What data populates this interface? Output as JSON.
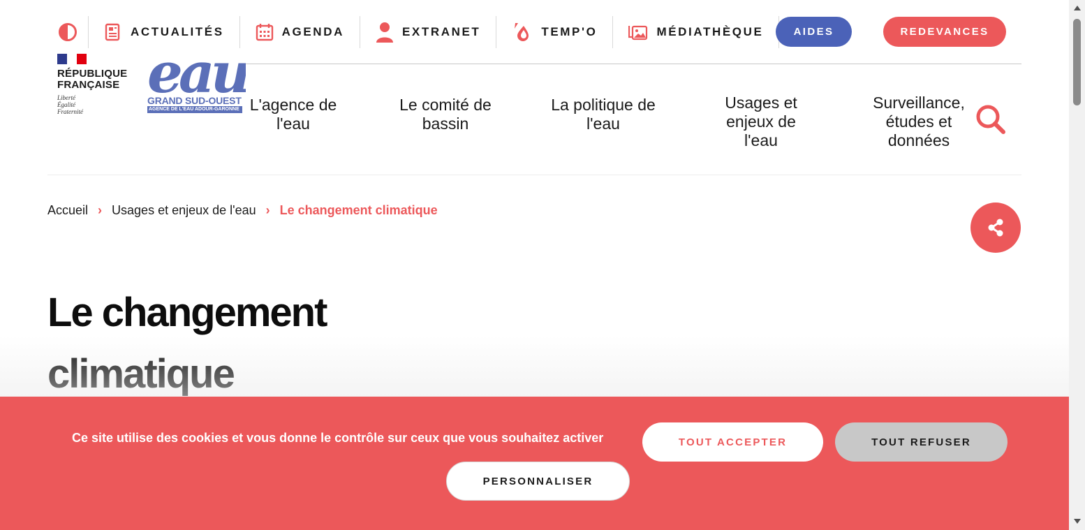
{
  "colors": {
    "accent_red": "#ec585a",
    "accent_blue": "#4b62b8",
    "text": "#1a1a1a"
  },
  "utility_nav": {
    "contrast_icon": "contrast-icon",
    "items": [
      {
        "label": "ACTUALITÉS",
        "icon": "newspaper-icon"
      },
      {
        "label": "AGENDA",
        "icon": "calendar-icon"
      },
      {
        "label": "EXTRANET",
        "icon": "user-icon"
      },
      {
        "label": "TEMP'O",
        "icon": "water-drop-icon"
      },
      {
        "label": "MÉDIATHÈQUE",
        "icon": "media-gallery-icon"
      }
    ],
    "aides_label": "AIDES",
    "redevances_label": "REDEVANCES"
  },
  "logos": {
    "rf_name": "RÉPUBLIQUE FRANÇAISE",
    "rf_motto": [
      "Liberté",
      "Égalité",
      "Fraternité"
    ],
    "eau_word": "eau",
    "eau_region": "GRAND SUD-OUEST",
    "eau_agency": "AGENCE DE L'EAU ADOUR-GARONNE"
  },
  "main_nav": [
    {
      "label": "L'agence de l'eau"
    },
    {
      "label": "Le comité de bassin"
    },
    {
      "label": "La politique de l'eau"
    },
    {
      "label": "Usages et enjeux de l'eau"
    },
    {
      "label": "Surveillance, études et données"
    }
  ],
  "breadcrumb": {
    "home": "Accueil",
    "parent": "Usages et enjeux de l'eau",
    "current": "Le changement climatique"
  },
  "page": {
    "title": "Le changement climatique"
  },
  "cookie_banner": {
    "message": "Ce site utilise des cookies et vous donne le contrôle sur ceux que vous souhaitez activer",
    "accept_label": "TOUT ACCEPTER",
    "refuse_label": "TOUT REFUSER",
    "customize_label": "PERSONNALISER"
  }
}
